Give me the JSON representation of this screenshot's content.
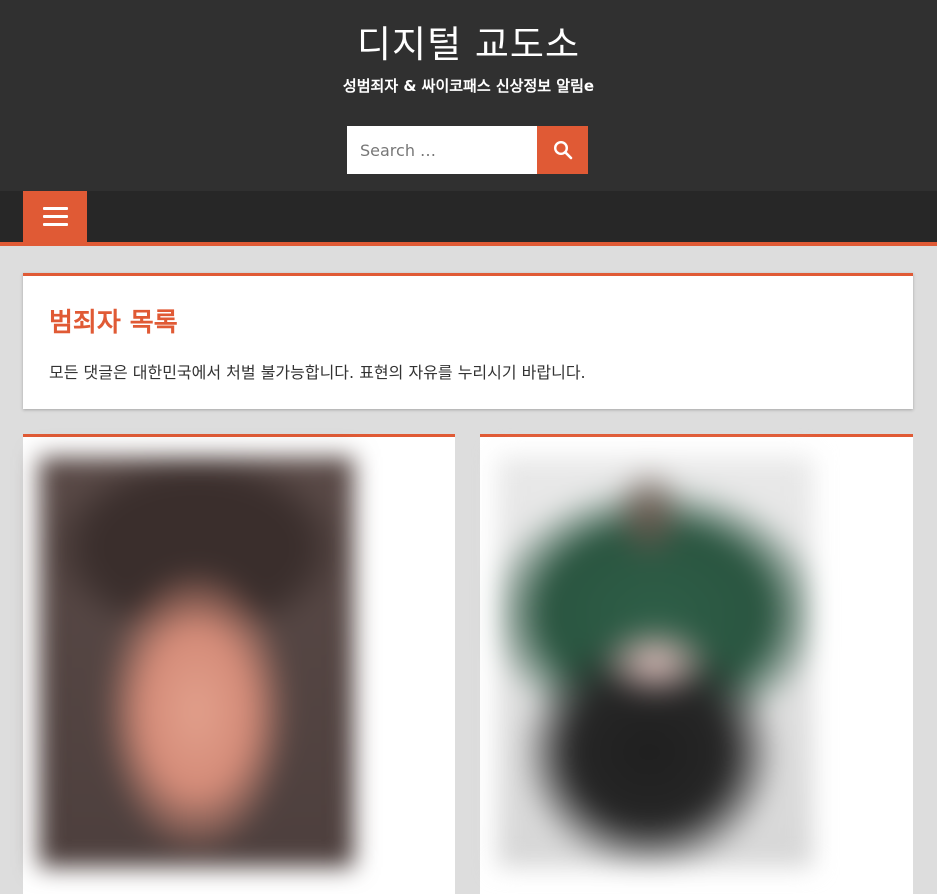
{
  "site": {
    "title": "디지털 교도소",
    "description": "성범죄자 & 싸이코패스 신상정보 알림e"
  },
  "search": {
    "placeholder": "Search …",
    "icon": "search-icon"
  },
  "nav": {
    "menu_icon": "hamburger-menu-icon"
  },
  "archive": {
    "title": "범죄자 목록",
    "description": "모든 댓글은 대한민국에서 처벌 불가능합니다. 표현의 자유를 누리시기 바랍니다."
  },
  "posts": [
    {
      "thumbnail": "blurred-portrait-photo"
    },
    {
      "thumbnail": "blurred-person-photo"
    }
  ],
  "colors": {
    "accent": "#e05a35",
    "header_bg": "#303030",
    "nav_bg": "#272727",
    "page_bg": "#dddddd"
  }
}
